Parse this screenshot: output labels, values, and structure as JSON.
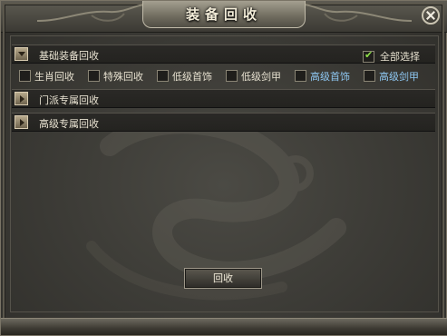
{
  "window": {
    "title": "装备回收"
  },
  "basic_section": {
    "label": "基础装备回收",
    "select_all": {
      "label": "全部选择",
      "checked": true
    }
  },
  "categories": [
    {
      "label": "生肖回收",
      "checked": false,
      "color": "#e6e0cf"
    },
    {
      "label": "特殊回收",
      "checked": false,
      "color": "#e6e0cf"
    },
    {
      "label": "低级首饰",
      "checked": false,
      "color": "#e6e0cf"
    },
    {
      "label": "低级剑甲",
      "checked": false,
      "color": "#e6e0cf"
    },
    {
      "label": "高级首饰",
      "checked": false,
      "color": "#8ec7f2"
    },
    {
      "label": "高级剑甲",
      "checked": false,
      "color": "#8ec7f2"
    }
  ],
  "sect_section": {
    "label": "门派专属回收"
  },
  "advanced_section": {
    "label": "高级专属回收"
  },
  "recycle_button": {
    "label": "回收"
  }
}
